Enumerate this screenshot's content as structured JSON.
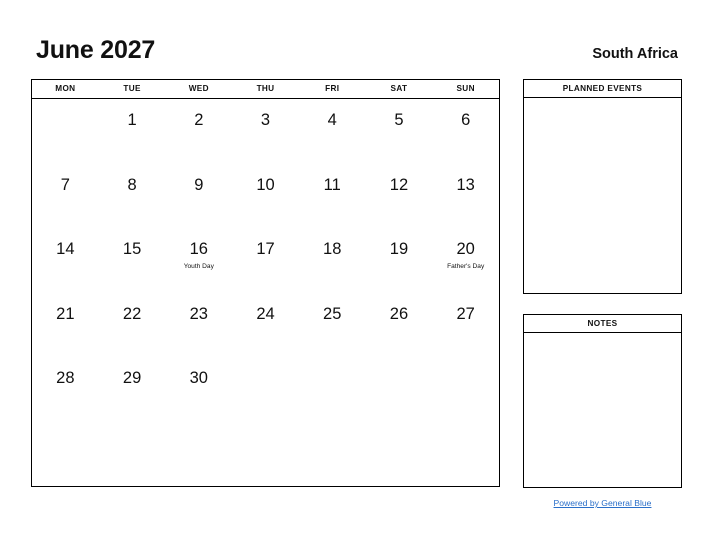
{
  "header": {
    "month_title": "June 2027",
    "country": "South Africa"
  },
  "calendar": {
    "weekday_headers": [
      "MON",
      "TUE",
      "WED",
      "THU",
      "FRI",
      "SAT",
      "SUN"
    ],
    "weeks": [
      [
        {
          "day": "",
          "event": ""
        },
        {
          "day": "1",
          "event": ""
        },
        {
          "day": "2",
          "event": ""
        },
        {
          "day": "3",
          "event": ""
        },
        {
          "day": "4",
          "event": ""
        },
        {
          "day": "5",
          "event": ""
        },
        {
          "day": "6",
          "event": ""
        }
      ],
      [
        {
          "day": "7",
          "event": ""
        },
        {
          "day": "8",
          "event": ""
        },
        {
          "day": "9",
          "event": ""
        },
        {
          "day": "10",
          "event": ""
        },
        {
          "day": "11",
          "event": ""
        },
        {
          "day": "12",
          "event": ""
        },
        {
          "day": "13",
          "event": ""
        }
      ],
      [
        {
          "day": "14",
          "event": ""
        },
        {
          "day": "15",
          "event": ""
        },
        {
          "day": "16",
          "event": "Youth Day"
        },
        {
          "day": "17",
          "event": ""
        },
        {
          "day": "18",
          "event": ""
        },
        {
          "day": "19",
          "event": ""
        },
        {
          "day": "20",
          "event": "Father's Day"
        }
      ],
      [
        {
          "day": "21",
          "event": ""
        },
        {
          "day": "22",
          "event": ""
        },
        {
          "day": "23",
          "event": ""
        },
        {
          "day": "24",
          "event": ""
        },
        {
          "day": "25",
          "event": ""
        },
        {
          "day": "26",
          "event": ""
        },
        {
          "day": "27",
          "event": ""
        }
      ],
      [
        {
          "day": "28",
          "event": ""
        },
        {
          "day": "29",
          "event": ""
        },
        {
          "day": "30",
          "event": ""
        },
        {
          "day": "",
          "event": ""
        },
        {
          "day": "",
          "event": ""
        },
        {
          "day": "",
          "event": ""
        },
        {
          "day": "",
          "event": ""
        }
      ],
      [
        {
          "day": "",
          "event": ""
        },
        {
          "day": "",
          "event": ""
        },
        {
          "day": "",
          "event": ""
        },
        {
          "day": "",
          "event": ""
        },
        {
          "day": "",
          "event": ""
        },
        {
          "day": "",
          "event": ""
        },
        {
          "day": "",
          "event": ""
        }
      ]
    ]
  },
  "panels": {
    "planned_events": {
      "title": "PLANNED EVENTS",
      "content": ""
    },
    "notes": {
      "title": "NOTES",
      "content": ""
    }
  },
  "footer": {
    "link_text": "Powered by General Blue",
    "link_color": "#2a6fc9"
  }
}
